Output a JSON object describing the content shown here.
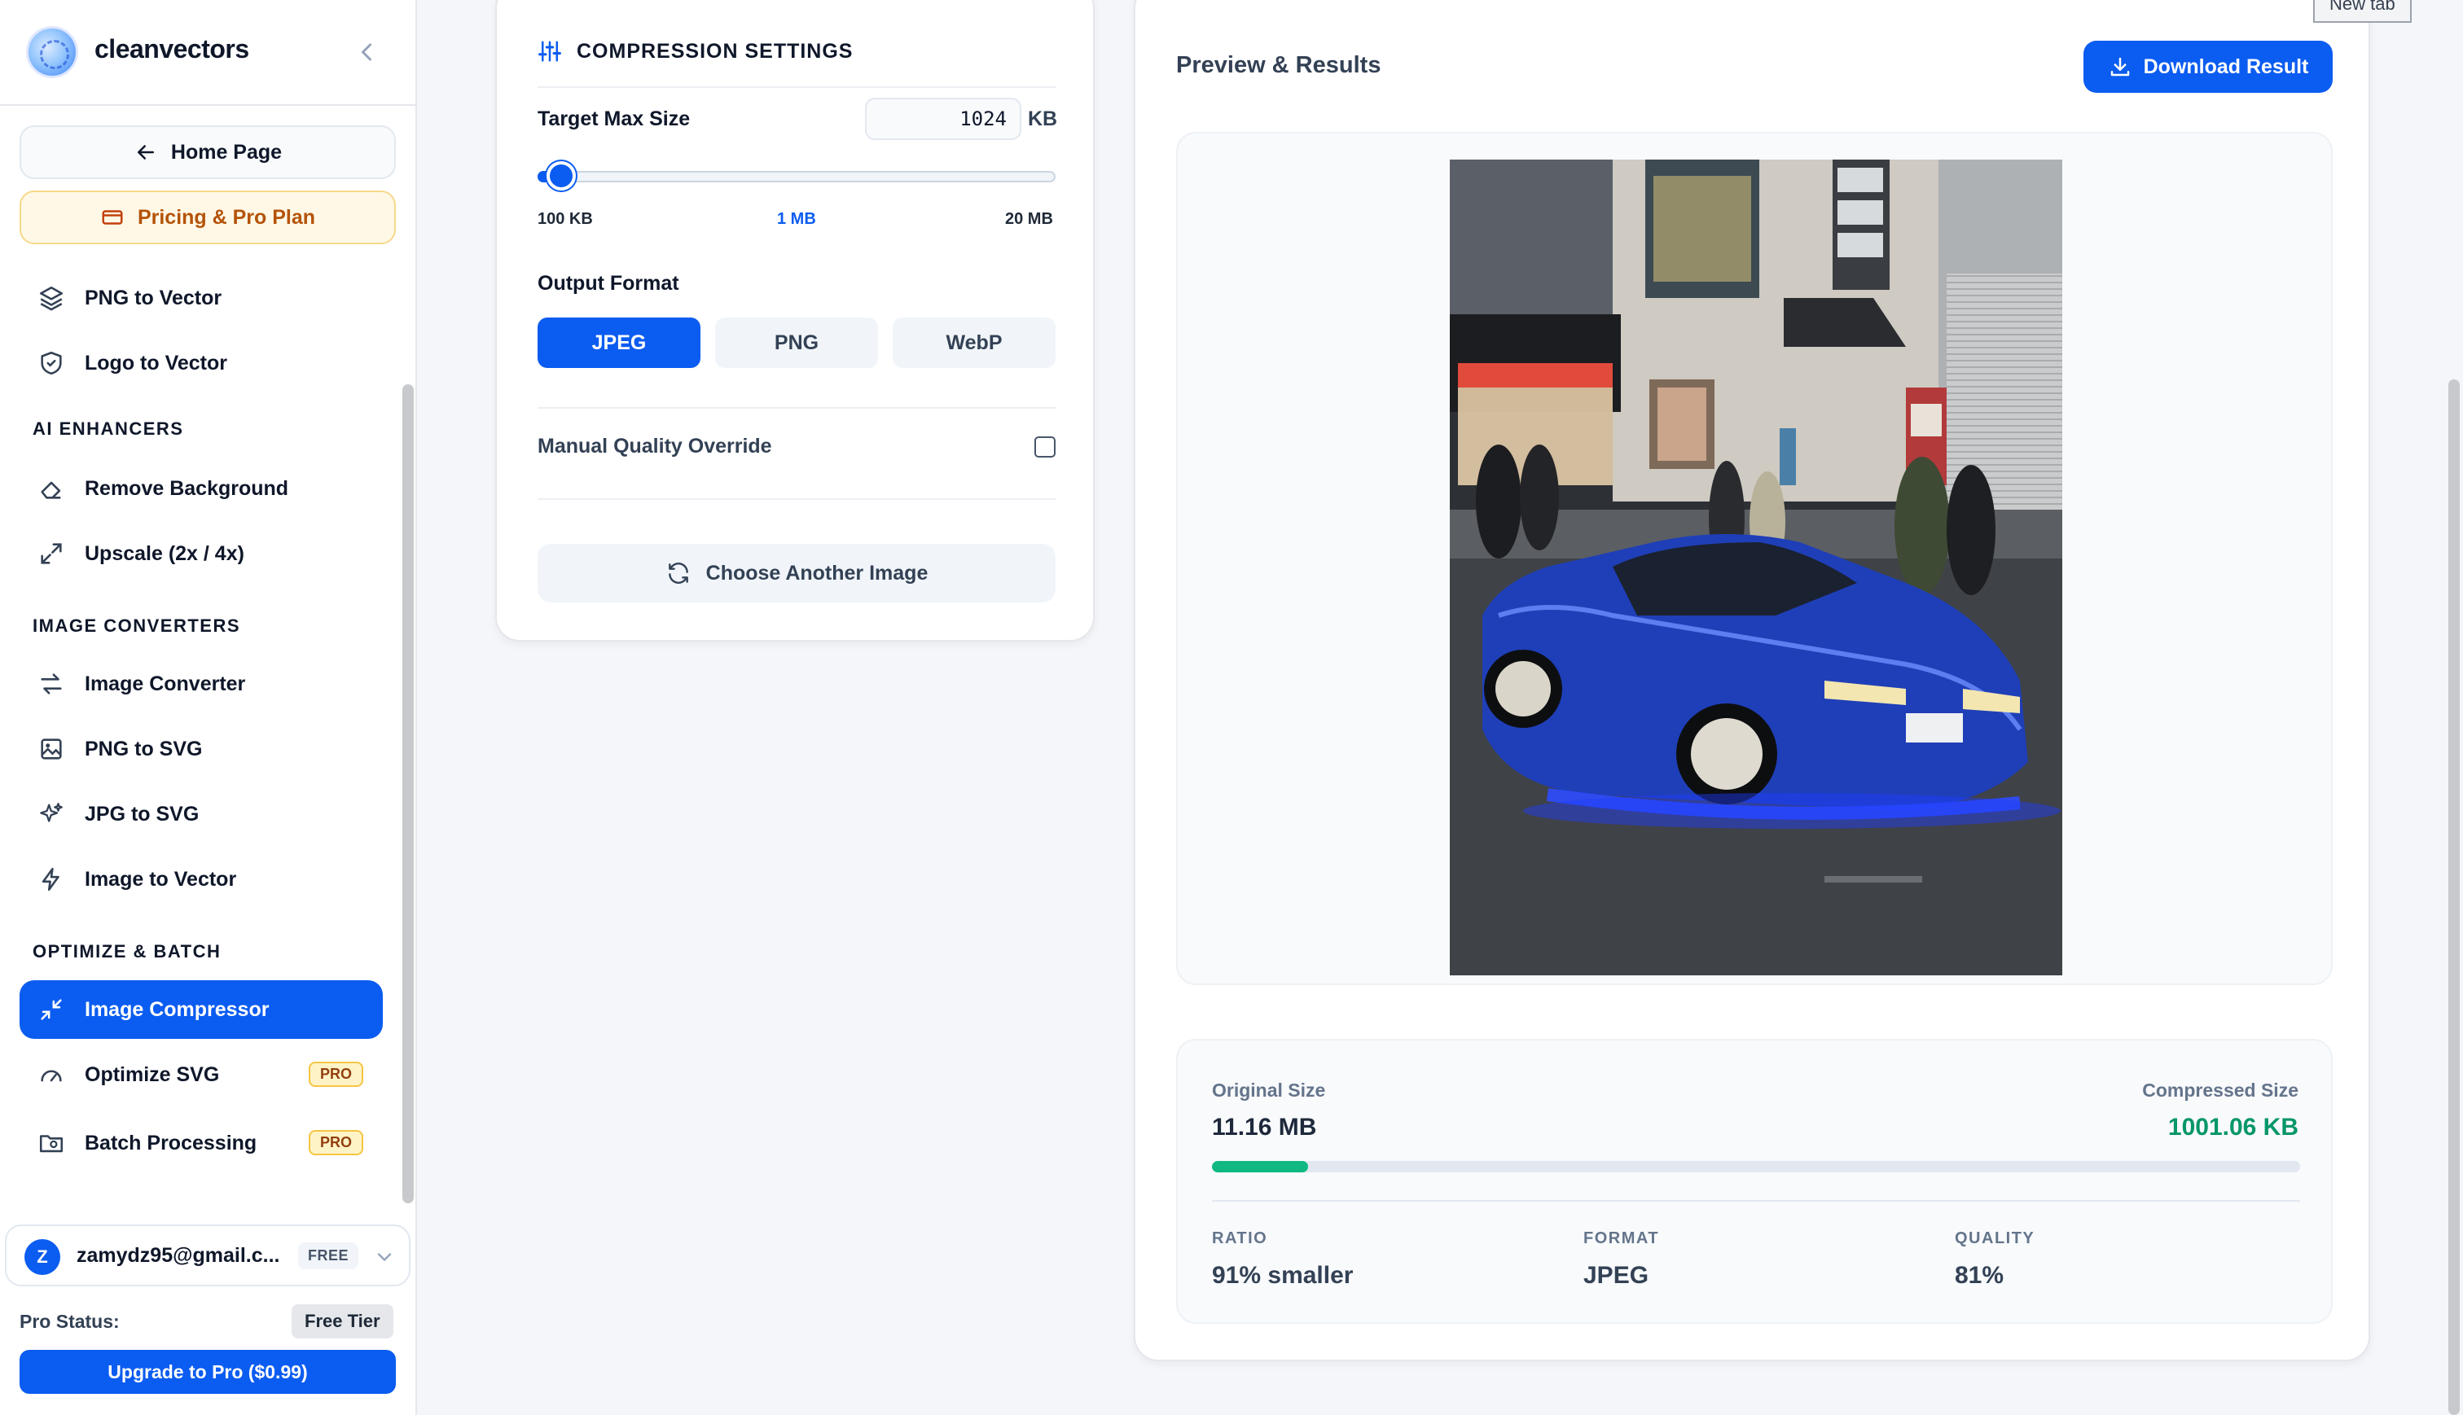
{
  "app": {
    "name": "cleanvectors"
  },
  "tooltip": "New tab",
  "top_buttons": {
    "home": "Home Page",
    "pricing": "Pricing & Pro Plan"
  },
  "sections": {
    "ai_enhancers": "AI ENHANCERS",
    "image_converters": "IMAGE CONVERTERS",
    "optimize_batch": "OPTIMIZE & BATCH"
  },
  "nav": {
    "png_to_vector": "PNG to Vector",
    "logo_to_vector": "Logo to Vector",
    "remove_background": "Remove Background",
    "upscale": "Upscale (2x / 4x)",
    "image_converter": "Image Converter",
    "png_to_svg": "PNG to SVG",
    "jpg_to_svg": "JPG to SVG",
    "image_to_vector": "Image to Vector",
    "image_compressor": "Image Compressor",
    "optimize_svg": "Optimize SVG",
    "batch_processing": "Batch Processing",
    "pro_badge": "PRO"
  },
  "user": {
    "initial": "Z",
    "email": "zamydz95@gmail.c...",
    "plan_badge": "FREE",
    "pro_status_label": "Pro Status:",
    "pro_status_value": "Free Tier",
    "upgrade_label": "Upgrade to Pro ($0.99)"
  },
  "settings": {
    "title": "COMPRESSION SETTINGS",
    "target_label": "Target Max Size",
    "target_value": "1024",
    "target_unit": "KB",
    "slider_fraction": 0.045,
    "tick_min": "100 KB",
    "tick_mid": "1 MB",
    "tick_max": "20 MB",
    "output_format_label": "Output Format",
    "formats": [
      "JPEG",
      "PNG",
      "WebP"
    ],
    "selected_format": "JPEG",
    "override_label": "Manual Quality Override",
    "override_checked": false,
    "choose_label": "Choose Another Image"
  },
  "preview": {
    "title": "Preview & Results",
    "download_label": "Download Result",
    "original_label": "Original Size",
    "original_value": "11.16 MB",
    "compressed_label": "Compressed Size",
    "compressed_value": "1001.06 KB",
    "compression_fraction": 0.088,
    "ratio_label": "RATIO",
    "ratio_value": "91% smaller",
    "format_label": "FORMAT",
    "format_value": "JPEG",
    "quality_label": "QUALITY",
    "quality_value": "81%"
  },
  "colors": {
    "accent": "#0b5cf0",
    "success": "#10b981",
    "pro_badge_bg": "#fef3c7",
    "pricing_bg": "#fff8e6"
  }
}
